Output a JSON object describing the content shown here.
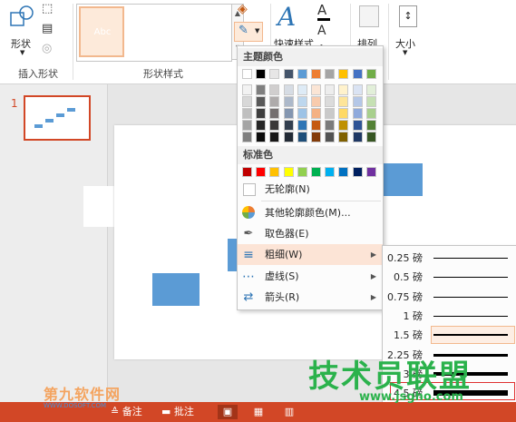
{
  "ribbon": {
    "insert_shapes_group": "插入形状",
    "shape_button": "形状",
    "shape_styles_group": "形状样式",
    "style_tiles": [
      {
        "label": "Abc",
        "color": "#5b9bd5"
      },
      {
        "label": "Abc",
        "color": "#ed7d31"
      },
      {
        "label": "Abc",
        "color": "#a5a5a5"
      }
    ],
    "quick_styles": "快速样式",
    "arrange": "排列",
    "size": "大小"
  },
  "menu": {
    "theme_colors_header": "主题颜色",
    "standard_colors_header": "标准色",
    "theme_top_row": [
      "#ffffff",
      "#000000",
      "#e7e6e6",
      "#44546a",
      "#5b9bd5",
      "#ed7d31",
      "#a5a5a5",
      "#ffc000",
      "#4472c4",
      "#70ad47"
    ],
    "theme_shades": [
      [
        "#f2f2f2",
        "#7f7f7f",
        "#d0cece",
        "#d6dce4",
        "#deebf6",
        "#fbe5d5",
        "#ededed",
        "#fff2cc",
        "#dae3f3",
        "#e2efd9"
      ],
      [
        "#d8d8d8",
        "#595959",
        "#aeabab",
        "#adb9ca",
        "#bdd7ee",
        "#f8cbad",
        "#dbdbdb",
        "#fee599",
        "#b4c7e7",
        "#c5e0b3"
      ],
      [
        "#bfbfbf",
        "#3f3f3f",
        "#757070",
        "#8496b0",
        "#9dc3e6",
        "#f4b183",
        "#c9c9c9",
        "#ffd965",
        "#8faadc",
        "#a8d08d"
      ],
      [
        "#a5a5a5",
        "#262626",
        "#3a3838",
        "#323f4f",
        "#2e75b5",
        "#c55a11",
        "#7b7b7b",
        "#bf9000",
        "#2f5496",
        "#538135"
      ],
      [
        "#7f7f7f",
        "#0c0c0c",
        "#171616",
        "#222a35",
        "#1e4e79",
        "#833c0b",
        "#525252",
        "#7f6000",
        "#1f3864",
        "#375623"
      ]
    ],
    "standard_colors": [
      "#c00000",
      "#ff0000",
      "#ffc000",
      "#ffff00",
      "#92d050",
      "#00b050",
      "#00b0f0",
      "#0070c0",
      "#002060",
      "#7030a0"
    ],
    "items": {
      "no_outline": "无轮廓(N)",
      "more_colors": "其他轮廓颜色(M)...",
      "eyedropper": "取色器(E)",
      "weight": "粗细(W)",
      "dashes": "虚线(S)",
      "arrows": "箭头(R)"
    }
  },
  "weights": [
    {
      "label": "0.25 磅",
      "thickness": 0.25
    },
    {
      "label": "0.5 磅",
      "thickness": 0.5
    },
    {
      "label": "0.75 磅",
      "thickness": 0.75
    },
    {
      "label": "1 磅",
      "thickness": 1
    },
    {
      "label": "1.5 磅",
      "thickness": 1.5
    },
    {
      "label": "2.25 磅",
      "thickness": 2.25
    },
    {
      "label": "3 磅",
      "thickness": 3
    },
    {
      "label": "4.5 磅",
      "thickness": 4.5
    }
  ],
  "thumbnail": {
    "number": "1"
  },
  "statusbar": {
    "notes": "备注",
    "comments": "批注"
  },
  "watermarks": {
    "site1": "第九软件网",
    "site1_url": "WWW.DOSOFT.COM",
    "site2": "技术员联盟",
    "site2_url": "www.jsgho.com"
  }
}
